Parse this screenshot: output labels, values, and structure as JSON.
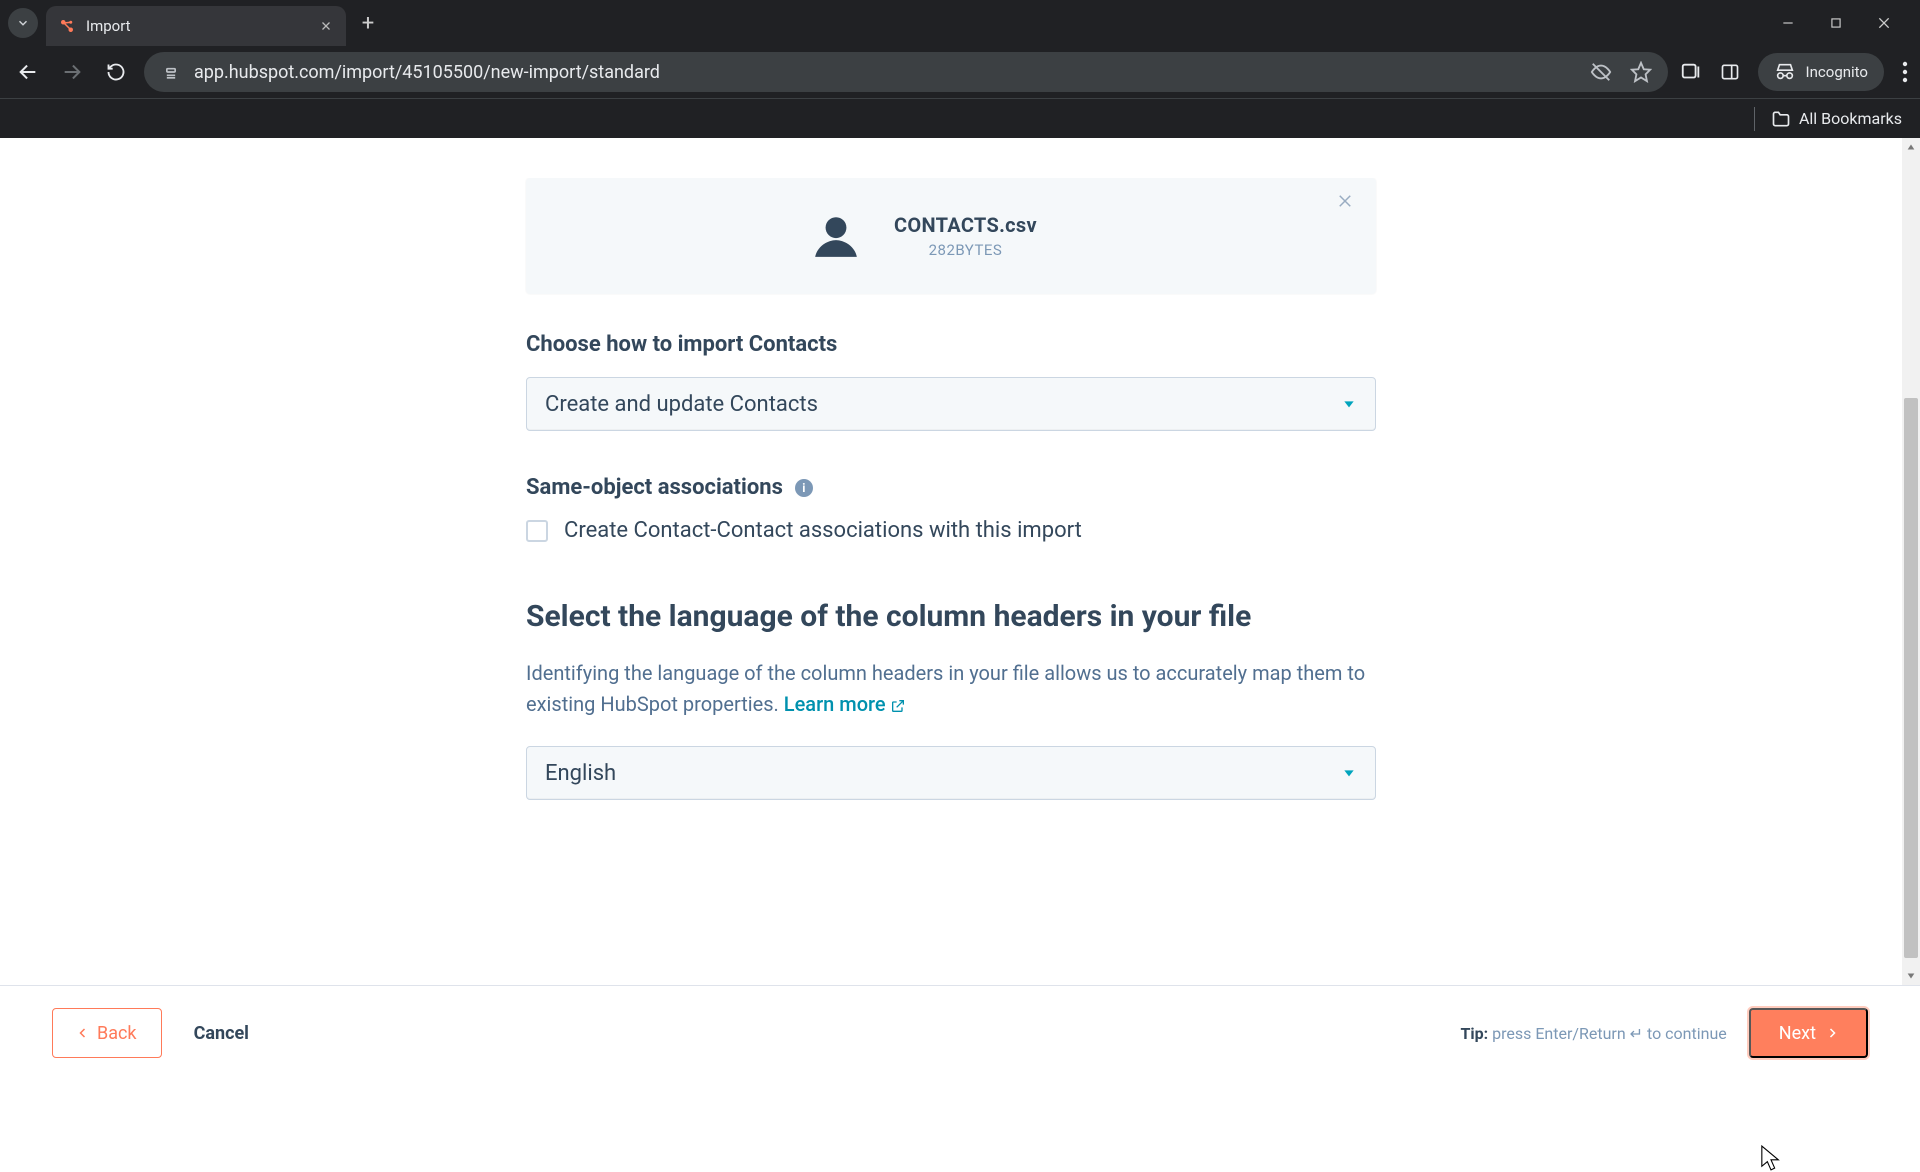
{
  "browser": {
    "tab_title": "Import",
    "url": "app.hubspot.com/import/45105500/new-import/standard",
    "incognito_label": "Incognito",
    "bookmarks_label": "All Bookmarks"
  },
  "file": {
    "name": "CONTACTS.csv",
    "size": "282BYTES"
  },
  "sections": {
    "import_mode_label": "Choose how to import Contacts",
    "import_mode_value": "Create and update Contacts",
    "assoc_label": "Same-object associations",
    "assoc_checkbox_label": "Create Contact-Contact associations with this import",
    "language_heading": "Select the language of the column headers in your file",
    "language_desc": "Identifying the language of the column headers in your file allows us to accurately map them to existing HubSpot properties. ",
    "learn_more": "Learn more",
    "language_value": "English"
  },
  "footer": {
    "back": "Back",
    "cancel": "Cancel",
    "tip_label": "Tip:",
    "tip_text": " press Enter/Return ↵ to continue",
    "next": "Next"
  }
}
